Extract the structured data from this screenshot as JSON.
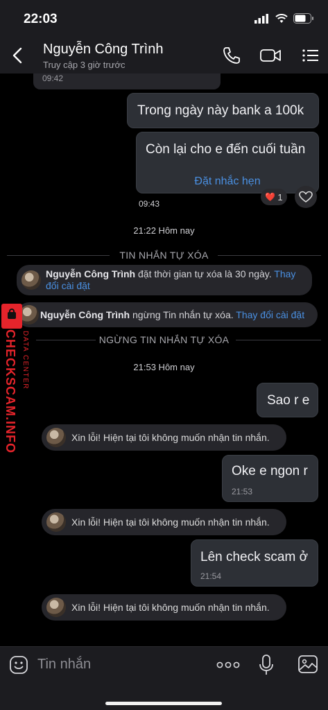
{
  "status_bar": {
    "time": "22:03"
  },
  "header": {
    "contact_name": "Nguyễn Công Trình",
    "status": "Truy cập 3 giờ trước"
  },
  "messages": {
    "partial_time": "09:42",
    "out1": "Trong ngày này  bank a 100k",
    "out2": "Còn lại cho e đến cuối tuần",
    "reminder_link": "Đặt nhắc hẹn",
    "out2_time": "09:43",
    "reaction_count": "1",
    "reaction_emoji": "❤️",
    "center_time_1": "21:22 Hôm nay",
    "divider_1": "TIN NHẮN TỰ XÓA",
    "sys1_name": "Nguyễn Công Trình",
    "sys1_text": " đặt thời gian tự xóa là 30 ngày. ",
    "sys1_link": "Thay đổi cài đặt",
    "sys2_name": "Nguyễn Công Trình",
    "sys2_text": " ngừng Tin nhắn tự xóa. ",
    "sys2_link": "Thay đổi cài đặt",
    "divider_2": "NGỪNG TIN NHẮN TỰ XÓA",
    "center_time_2": "21:53 Hôm nay",
    "out3": "Sao r e",
    "auto_reply": "Xin lỗi! Hiện tại tôi không muốn nhận tin nhắn.",
    "out4": "Oke e ngon r",
    "out4_time": "21:53",
    "out5": "Lên check scam ở",
    "out5_time": "21:54"
  },
  "watermark": {
    "brand": "CHECKSCAM.INFO",
    "sub": "DATA CENTER"
  },
  "input": {
    "placeholder": "Tin nhắn"
  },
  "colors": {
    "link": "#4a90e2",
    "watermark": "#e5242b",
    "bubble": "#2d3036"
  }
}
